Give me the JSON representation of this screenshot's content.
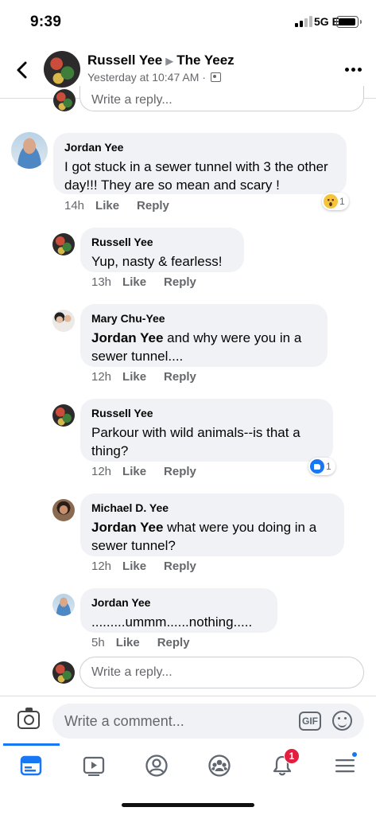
{
  "status_bar": {
    "time": "9:39",
    "network": "5G E"
  },
  "header": {
    "author": "Russell Yee",
    "group": "The Yeez",
    "timestamp": "Yesterday at 10:47 AM ·",
    "icons": [
      "back-arrow-icon",
      "audience-icon",
      "more-icon"
    ]
  },
  "top_reply_placeholder": "Write a reply...",
  "comments": [
    {
      "author": "Jordan Yee",
      "text": "I got stuck in a sewer tunnel with 3 the other day!!! They are so mean and scary !",
      "time": "14h",
      "like": "Like",
      "reply": "Reply",
      "reaction": {
        "icon": "wow-icon",
        "count": "1"
      }
    },
    {
      "author": "Russell Yee",
      "text": "Yup, nasty & fearless!",
      "time": "13h",
      "like": "Like",
      "reply": "Reply"
    },
    {
      "author": "Mary Chu-Yee",
      "mention": "Jordan Yee",
      "text": " and why were you in a sewer tunnel....",
      "time": "12h",
      "like": "Like",
      "reply": "Reply"
    },
    {
      "author": "Russell Yee",
      "text": "Parkour with wild animals--is that a thing?",
      "time": "12h",
      "like": "Like",
      "reply": "Reply",
      "reaction": {
        "icon": "like-icon",
        "count": "1"
      }
    },
    {
      "author": "Michael D. Yee",
      "mention": "Jordan Yee",
      "text": " what were you doing in a sewer tunnel?",
      "time": "12h",
      "like": "Like",
      "reply": "Reply"
    },
    {
      "author": "Jordan Yee",
      "text": ".........ummm......nothing.....",
      "time": "5h",
      "like": "Like",
      "reply": "Reply"
    }
  ],
  "reply_placeholder": "Write a reply...",
  "comment_bar": {
    "placeholder": "Write a comment...",
    "gif_label": "GIF"
  },
  "tab_bar": {
    "tabs": [
      "news-feed-icon",
      "watch-icon",
      "profile-icon",
      "groups-icon",
      "notifications-icon",
      "menu-icon"
    ],
    "notifications_badge": "1"
  },
  "colors": {
    "accent": "#1877f2",
    "badge": "#e41e3f",
    "bubble": "#f0f2f5"
  }
}
